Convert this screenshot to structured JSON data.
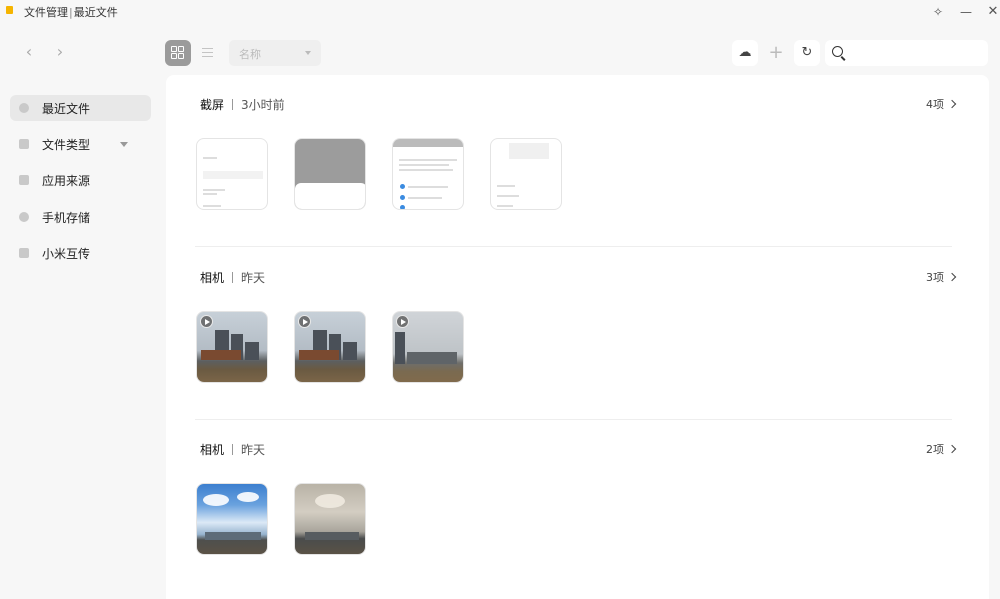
{
  "window": {
    "app_name": "文件管理",
    "separator": "|",
    "location": "最近文件"
  },
  "toolbar": {
    "sort_label": "名称",
    "search_placeholder": ""
  },
  "sidebar": {
    "items": [
      {
        "label": "最近文件",
        "icon": "clock-icon",
        "active": true
      },
      {
        "label": "文件类型",
        "icon": "file-type-icon",
        "has_dropdown": true
      },
      {
        "label": "应用来源",
        "icon": "apps-icon"
      },
      {
        "label": "手机存储",
        "icon": "storage-pie-icon"
      },
      {
        "label": "小米互传",
        "icon": "transfer-folder-icon"
      }
    ]
  },
  "groups": [
    {
      "title": "截屏",
      "time": "3小时前",
      "count": "4项",
      "kind": "screenshot",
      "items": 4
    },
    {
      "title": "相机",
      "time": "昨天",
      "count": "3项",
      "kind": "video",
      "items": 3
    },
    {
      "title": "相机",
      "time": "昨天",
      "count": "2项",
      "kind": "photo",
      "items": 2
    }
  ],
  "colors": {
    "accent": "#f5b400",
    "active_view_bg": "#9b9b9b",
    "panel_bg": "#ffffff",
    "window_bg": "#f7f7f7"
  }
}
